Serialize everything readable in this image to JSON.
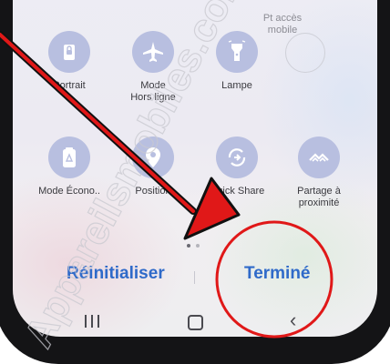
{
  "tiles_top": [
    {
      "label": "Pt accès\nmobile",
      "icon": "hotspot-icon"
    },
    {
      "label": "Portrait",
      "icon": "portrait-lock-icon"
    },
    {
      "label": "Mode\nHors ligne",
      "icon": "airplane-icon"
    },
    {
      "label": "Lampe",
      "icon": "flashlight-icon"
    }
  ],
  "tiles_bottom": [
    {
      "label": "Mode Écono..",
      "icon": "battery-recycle-icon"
    },
    {
      "label": "Position",
      "icon": "location-pin-icon"
    },
    {
      "label": "Quick Share",
      "icon": "quick-share-icon"
    },
    {
      "label": "Partage à\nproximité",
      "icon": "nearby-share-icon"
    }
  ],
  "actions": {
    "reset_label": "Réinitialiser",
    "done_label": "Terminé"
  },
  "colors": {
    "tile_bg": "#b8bfe0",
    "accent": "#2f6ac9",
    "annotation_red": "#e01818"
  },
  "watermark": {
    "text": "Appareilsmobiles.com"
  }
}
